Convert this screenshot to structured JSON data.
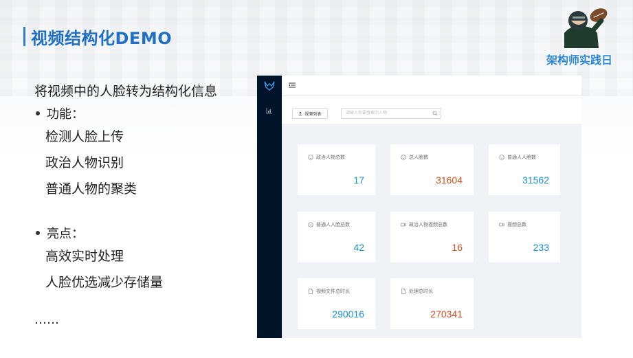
{
  "slide": {
    "title": "视频结构化DEMO",
    "brand_text": "架构师实践日",
    "intro": "将视频中的人脸转为结构化信息",
    "sections": [
      {
        "heading": "功能：",
        "items": [
          "检测人脸上传",
          "政治人物识别",
          "普通人物的聚类"
        ]
      },
      {
        "heading": "亮点：",
        "items": [
          "高效实时处理",
          "人脸优选减少存储量"
        ]
      }
    ],
    "ellipsis": "……"
  },
  "app": {
    "toolbar": {
      "video_list_label": "视频列表",
      "search_placeholder": "请输入你要搜索的人物"
    },
    "cards": [
      {
        "label": "政治人物总数",
        "value": "17",
        "icon": "smile-icon",
        "color": "#1890d5"
      },
      {
        "label": "总人脸数",
        "value": "31604",
        "icon": "smile-icon",
        "color": "#c8501e"
      },
      {
        "label": "普通人人脸数",
        "value": "31562",
        "icon": "smile-icon",
        "color": "#1890d5"
      },
      {
        "label": "普通人人脸总数",
        "value": "42",
        "icon": "smile-icon",
        "color": "#1890d5"
      },
      {
        "label": "政治人物视频总数",
        "value": "16",
        "icon": "video-icon",
        "color": "#c8501e"
      },
      {
        "label": "视频总数",
        "value": "233",
        "icon": "video-icon",
        "color": "#1890d5"
      },
      {
        "label": "视频文件总时长",
        "value": "290016",
        "icon": "file-icon",
        "color": "#1890d5"
      },
      {
        "label": "处理总时长",
        "value": "270341",
        "icon": "file-icon",
        "color": "#c8501e"
      }
    ]
  },
  "colors": {
    "accent": "#2a7fd4",
    "sidebar": "#001529",
    "value_blue": "#1890d5",
    "value_orange": "#c8501e"
  }
}
